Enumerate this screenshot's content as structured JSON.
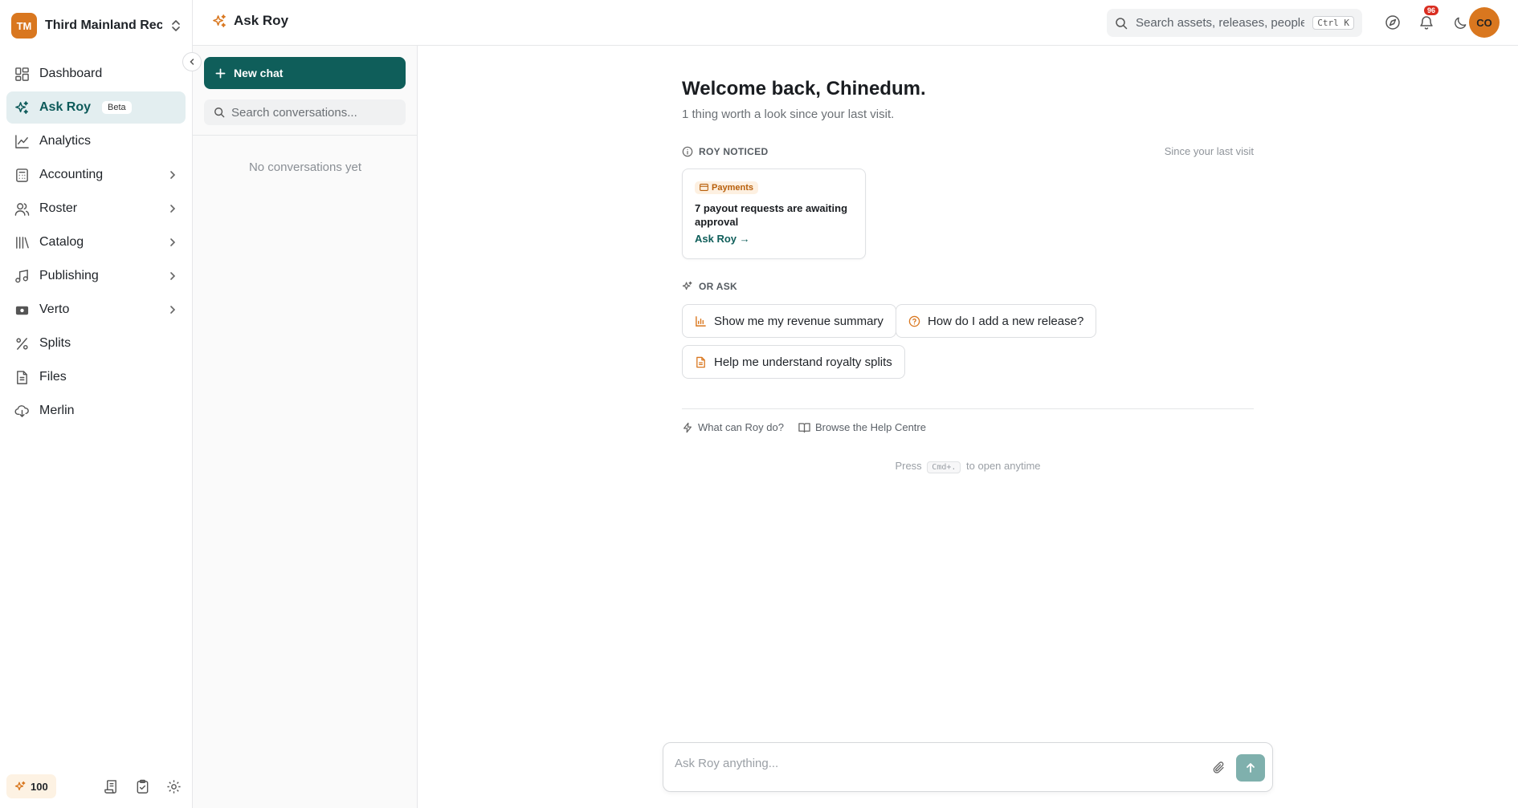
{
  "org": {
    "initials": "TM",
    "name": "Third Mainland Rec..."
  },
  "nav": [
    {
      "label": "Dashboard",
      "icon": "dashboard-icon",
      "chevron": false
    },
    {
      "label": "Ask Roy",
      "icon": "sparkle-icon",
      "badge": "Beta",
      "active": true
    },
    {
      "label": "Analytics",
      "icon": "chart-line-icon",
      "chevron": false
    },
    {
      "label": "Accounting",
      "icon": "calculator-icon",
      "chevron": true
    },
    {
      "label": "Roster",
      "icon": "users-icon",
      "chevron": true
    },
    {
      "label": "Catalog",
      "icon": "library-icon",
      "chevron": true
    },
    {
      "label": "Publishing",
      "icon": "music-note-icon",
      "chevron": true
    },
    {
      "label": "Verto",
      "icon": "wallet-icon",
      "chevron": true
    },
    {
      "label": "Splits",
      "icon": "percent-icon",
      "chevron": false
    },
    {
      "label": "Files",
      "icon": "file-icon",
      "chevron": false
    },
    {
      "label": "Merlin",
      "icon": "cloud-download-icon",
      "chevron": false
    }
  ],
  "footer": {
    "credits": "100"
  },
  "topbar": {
    "title": "Ask Roy",
    "search_placeholder": "Search assets, releases, people...",
    "search_shortcut": "Ctrl K",
    "notification_count": "96",
    "avatar_initials": "CO"
  },
  "conversations": {
    "new_chat_label": "New chat",
    "search_placeholder": "Search conversations...",
    "empty_text": "No conversations yet"
  },
  "main": {
    "welcome": "Welcome back, Chinedum.",
    "subtitle": "1 thing worth a look since your last visit.",
    "noticed_heading": "ROY NOTICED",
    "noticed_meta": "Since your last visit",
    "card": {
      "tag": "Payments",
      "title": "7 payout requests are awaiting approval",
      "link": "Ask Roy →"
    },
    "ask_heading": "OR ASK",
    "suggestions": [
      {
        "label": "Show me my revenue summary",
        "icon": "bar-chart-icon"
      },
      {
        "label": "How do I add a new release?",
        "icon": "help-circle-icon"
      },
      {
        "label": "Help me understand royalty splits",
        "icon": "document-icon"
      }
    ],
    "help_links": [
      {
        "label": "What can Roy do?",
        "icon": "bolt-icon"
      },
      {
        "label": "Browse the Help Centre",
        "icon": "book-icon"
      }
    ],
    "hint_prefix": "Press",
    "hint_key": "Cmd+.",
    "hint_suffix": "to open anytime",
    "composer_placeholder": "Ask Roy anything..."
  },
  "colors": {
    "brand": "#0f5e5a",
    "accent": "#d9771f",
    "badge": "#d92d20"
  }
}
